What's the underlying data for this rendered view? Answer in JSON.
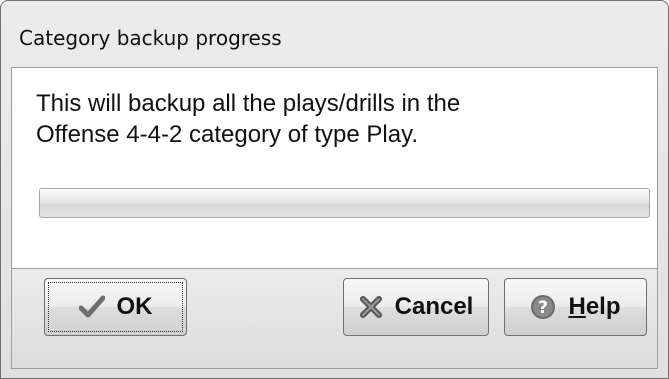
{
  "window": {
    "title": "Category backup progress"
  },
  "message": {
    "line1": "This will backup all the plays/drills in the",
    "line2": "Offense 4-4-2 category of type Play."
  },
  "progress": {
    "value_percent": 0
  },
  "buttons": {
    "ok": {
      "label": "OK",
      "icon": "checkmark-icon"
    },
    "cancel": {
      "label": "Cancel",
      "icon": "x-icon"
    },
    "help": {
      "mnemonic": "H",
      "label_rest": "elp",
      "icon": "help-icon"
    }
  }
}
